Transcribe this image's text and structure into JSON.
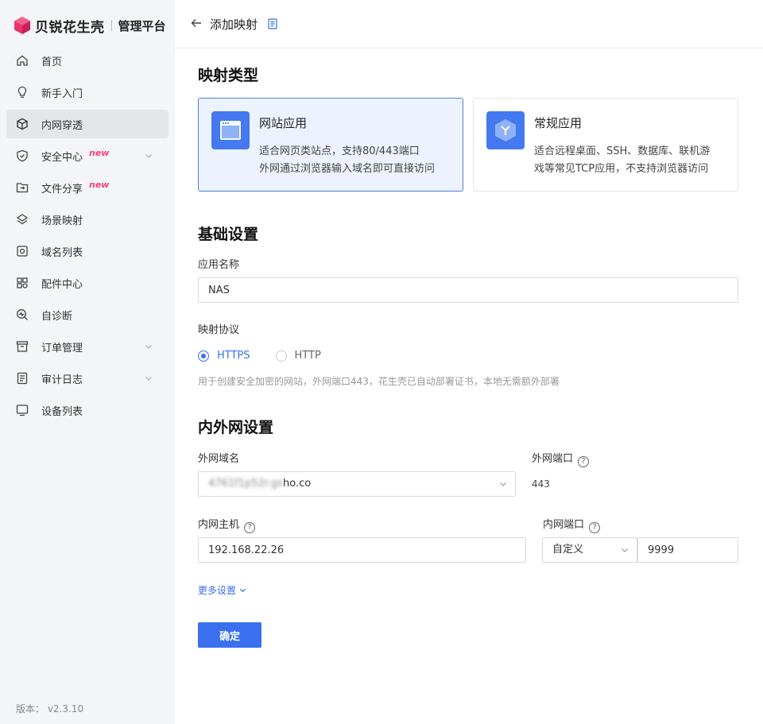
{
  "brand": {
    "name": "贝锐花生壳",
    "platform": "管理平台",
    "color": "#e8336d"
  },
  "sidebar": {
    "items": [
      {
        "label": "首页",
        "icon": "home-icon"
      },
      {
        "label": "新手入门",
        "icon": "lightbulb-icon"
      },
      {
        "label": "内网穿透",
        "icon": "cube-icon",
        "active": true
      },
      {
        "label": "安全中心",
        "icon": "shield-icon",
        "badge": "new",
        "expandable": true
      },
      {
        "label": "文件分享",
        "icon": "file-share-icon",
        "badge": "new"
      },
      {
        "label": "场景映射",
        "icon": "scene-icon"
      },
      {
        "label": "域名列表",
        "icon": "domain-icon"
      },
      {
        "label": "配件中心",
        "icon": "apps-icon"
      },
      {
        "label": "自诊断",
        "icon": "diagnose-icon"
      },
      {
        "label": "订单管理",
        "icon": "order-icon",
        "expandable": true
      },
      {
        "label": "审计日志",
        "icon": "log-icon",
        "expandable": true
      },
      {
        "label": "设备列表",
        "icon": "monitor-icon"
      }
    ],
    "version": "版本： v2.3.10"
  },
  "header": {
    "title": "添加映射"
  },
  "mapping_type": {
    "title": "映射类型",
    "cards": [
      {
        "title": "网站应用",
        "desc1": "适合网页类站点，支持80/443端口",
        "desc2": "外网通过浏览器输入域名即可直接访问",
        "selected": true
      },
      {
        "title": "常规应用",
        "desc1": "适合远程桌面、SSH、数据库、联机游",
        "desc2": "戏等常见TCP应用，不支持浏览器访问",
        "selected": false
      }
    ]
  },
  "basic": {
    "title": "基础设置",
    "app_name_label": "应用名称",
    "app_name_value": "NAS",
    "protocol_label": "映射协议",
    "protocols": [
      "HTTPS",
      "HTTP"
    ],
    "selected_protocol": "HTTPS",
    "hint": "用于创建安全加密的网站，外网端口443，花生壳已自动部署证书，本地无需额外部署"
  },
  "network": {
    "title": "内外网设置",
    "ext_domain_label": "外网域名",
    "ext_domain_blurred": "4761f1p52r.gs",
    "ext_domain_visible": "ho.co",
    "ext_port_label": "外网端口",
    "ext_port_value": "443",
    "int_host_label": "内网主机",
    "int_host_value": "192.168.22.26",
    "int_port_label": "内网端口",
    "int_port_mode": "自定义",
    "int_port_value": "9999"
  },
  "more_settings": "更多设置",
  "confirm_label": "确定",
  "colors": {
    "accent": "#3a6ff0",
    "badge": "#f5417a"
  }
}
